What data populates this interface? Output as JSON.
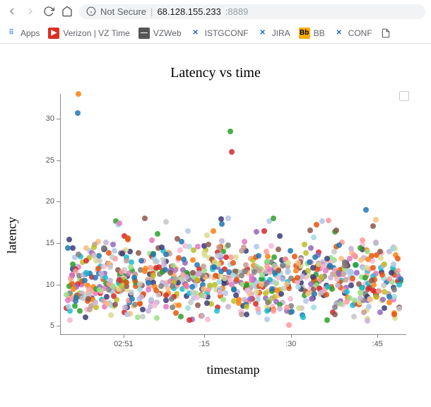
{
  "browser": {
    "back": "←",
    "forward": "→",
    "reload": "⟳",
    "home": "⌂",
    "secure_label": "Not Secure",
    "url_host": "68.128.155.233",
    "url_port": ":8889"
  },
  "bookmarks": [
    {
      "label": "Apps",
      "icon_bg": "#fff",
      "icon_text": "⠿",
      "icon_color": "#4285f4"
    },
    {
      "label": "Verizon | VZ Time",
      "icon_bg": "#d93025",
      "icon_text": "▶",
      "icon_color": "#fff"
    },
    {
      "label": "VZWeb",
      "icon_bg": "#555",
      "icon_text": "—",
      "icon_color": "#fff"
    },
    {
      "label": "ISTGCONF",
      "icon_bg": "#fff",
      "icon_text": "✕",
      "icon_color": "#1967d2"
    },
    {
      "label": "JIRA",
      "icon_bg": "#fff",
      "icon_text": "✕",
      "icon_color": "#1967d2"
    },
    {
      "label": "BB",
      "icon_bg": "#f9ab00",
      "icon_text": "Bb",
      "icon_color": "#000"
    },
    {
      "label": "CONF",
      "icon_bg": "#fff",
      "icon_text": "✕",
      "icon_color": "#1967d2"
    }
  ],
  "chart_data": {
    "type": "scatter",
    "title": "Latency vs time",
    "xlabel": "timestamp",
    "ylabel": "latency",
    "ylim": [
      4,
      33
    ],
    "xlim": [
      0,
      60
    ],
    "x_ticks": [
      {
        "pos": 11,
        "label": "02:51"
      },
      {
        "pos": 25,
        "label": ":15"
      },
      {
        "pos": 40,
        "label": ":30"
      },
      {
        "pos": 55,
        "label": ":45"
      }
    ],
    "y_ticks": [
      5,
      10,
      15,
      20,
      25,
      30
    ],
    "colors": [
      "#1f77b4",
      "#ff7f0e",
      "#2ca02c",
      "#d62728",
      "#9467bd",
      "#8c564b",
      "#e377c2",
      "#7f7f7f",
      "#bcbd22",
      "#17becf",
      "#aec7e8",
      "#ffbb78",
      "#98df8a",
      "#ff9896",
      "#c5b0d5",
      "#c49c94",
      "#f7b6d2",
      "#c7c7c7",
      "#dbdb8d",
      "#9edae5",
      "#393b79",
      "#e6550d"
    ],
    "outliers": [
      {
        "x": 3.2,
        "y": 33.0,
        "color": "#ff7f0e"
      },
      {
        "x": 3.0,
        "y": 30.7,
        "color": "#1f77b4"
      },
      {
        "x": 29.5,
        "y": 28.5,
        "color": "#2ca02c"
      },
      {
        "x": 29.8,
        "y": 26.0,
        "color": "#d62728"
      },
      {
        "x": 53.0,
        "y": 19.0,
        "color": "#1f77b4"
      },
      {
        "x": 37.0,
        "y": 18.0,
        "color": "#2ca02c"
      }
    ],
    "dense_cluster": {
      "x_range": [
        1,
        59
      ],
      "y_range": [
        5,
        16
      ],
      "approx_point_count": 2000,
      "description": "Dense multi-colored scatter of latency values mostly between 5 and 16 across the full timestamp range, with heavier density in 7–13."
    }
  }
}
